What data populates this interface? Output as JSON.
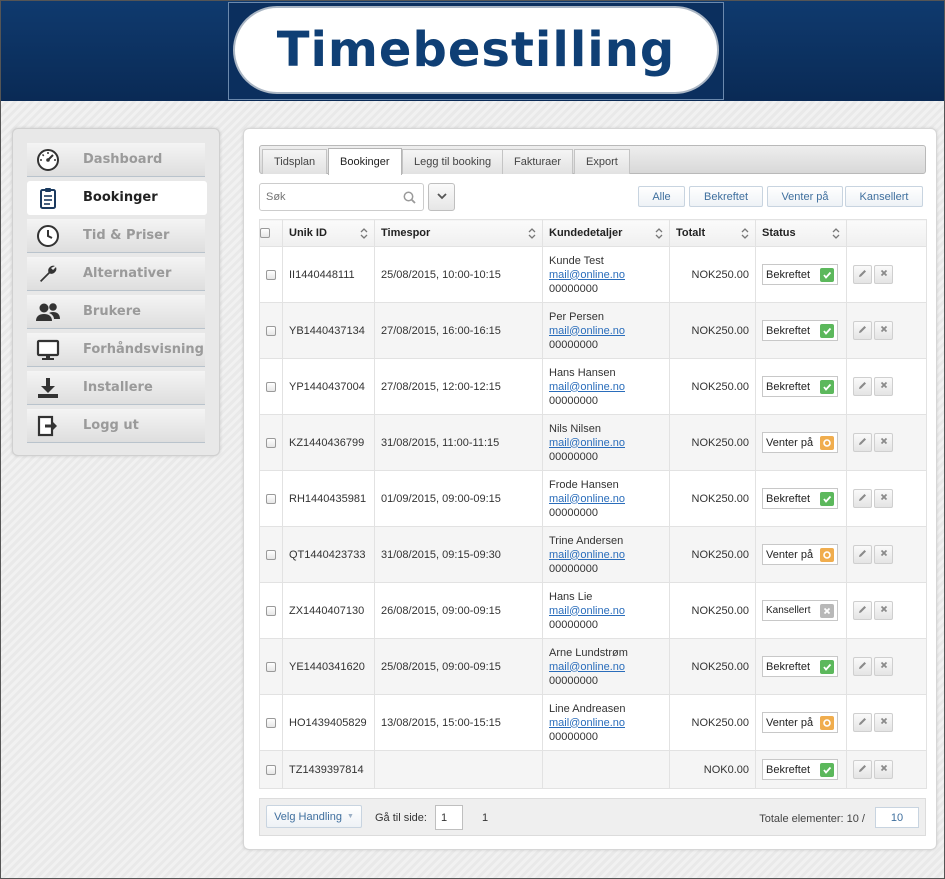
{
  "header": {
    "title": "Timebestilling"
  },
  "sidebar": {
    "items": [
      {
        "label": "Dashboard",
        "icon": "dashboard-gauge-icon",
        "active": false
      },
      {
        "label": "Bookinger",
        "icon": "clipboard-icon",
        "active": true
      },
      {
        "label": "Tid & Priser",
        "icon": "clock-icon",
        "active": false
      },
      {
        "label": "Alternativer",
        "icon": "wrench-icon",
        "active": false
      },
      {
        "label": "Brukere",
        "icon": "users-icon",
        "active": false
      },
      {
        "label": "Forhåndsvisning",
        "icon": "monitor-icon",
        "active": false
      },
      {
        "label": "Installere",
        "icon": "download-icon",
        "active": false
      },
      {
        "label": "Logg ut",
        "icon": "logout-icon",
        "active": false
      }
    ]
  },
  "tabs": [
    "Tidsplan",
    "Bookinger",
    "Legg til booking",
    "Fakturaer",
    "Export"
  ],
  "active_tab": "Bookinger",
  "search": {
    "placeholder": "Søk",
    "value": ""
  },
  "filters": [
    "Alle",
    "Bekreftet",
    "Venter på",
    "Kansellert"
  ],
  "table": {
    "columns": [
      "Unik ID",
      "Timespor",
      "Kundedetaljer",
      "Totalt",
      "Status"
    ],
    "rows": [
      {
        "id": "II1440448111",
        "slot": "25/08/2015, 10:00-10:15",
        "name": "Kunde Test",
        "email": "mail@online.no",
        "phone": "00000000",
        "total": "NOK250.00",
        "status": "Bekreftet"
      },
      {
        "id": "YB1440437134",
        "slot": "27/08/2015, 16:00-16:15",
        "name": "Per Persen",
        "email": "mail@online.no",
        "phone": "00000000",
        "total": "NOK250.00",
        "status": "Bekreftet"
      },
      {
        "id": "YP1440437004",
        "slot": "27/08/2015, 12:00-12:15",
        "name": "Hans Hansen",
        "email": "mail@online.no",
        "phone": "00000000",
        "total": "NOK250.00",
        "status": "Bekreftet"
      },
      {
        "id": "KZ1440436799",
        "slot": "31/08/2015, 11:00-11:15",
        "name": "Nils Nilsen",
        "email": "mail@online.no",
        "phone": "00000000",
        "total": "NOK250.00",
        "status": "Venter på"
      },
      {
        "id": "RH1440435981",
        "slot": "01/09/2015, 09:00-09:15",
        "name": "Frode Hansen",
        "email": "mail@online.no",
        "phone": "00000000",
        "total": "NOK250.00",
        "status": "Bekreftet"
      },
      {
        "id": "QT1440423733",
        "slot": "31/08/2015, 09:15-09:30",
        "name": "Trine Andersen",
        "email": "mail@online.no",
        "phone": "00000000",
        "total": "NOK250.00",
        "status": "Venter på"
      },
      {
        "id": "ZX1440407130",
        "slot": "26/08/2015, 09:00-09:15",
        "name": "Hans Lie",
        "email": "mail@online.no",
        "phone": "00000000",
        "total": "NOK250.00",
        "status": "Kansellert"
      },
      {
        "id": "YE1440341620",
        "slot": "25/08/2015, 09:00-09:15",
        "name": "Arne Lundstrøm",
        "email": "mail@online.no",
        "phone": "00000000",
        "total": "NOK250.00",
        "status": "Bekreftet"
      },
      {
        "id": "HO1439405829",
        "slot": "13/08/2015, 15:00-15:15",
        "name": "Line Andreasen",
        "email": "mail@online.no",
        "phone": "00000000",
        "total": "NOK250.00",
        "status": "Venter på"
      },
      {
        "id": "TZ1439397814",
        "slot": "",
        "name": "",
        "email": "",
        "phone": "",
        "total": "NOK0.00",
        "status": "Bekreftet"
      }
    ]
  },
  "status_colors": {
    "Bekreftet": "#5cb85c",
    "Venter på": "#f0ad4e",
    "Kansellert": "#b8b8b8"
  },
  "footer": {
    "action_label": "Velg Handling",
    "goto_label": "Gå til side:",
    "goto_value": "1",
    "current_page": "1",
    "total_label": "Totale elementer: 10 /",
    "per_page": "10"
  }
}
